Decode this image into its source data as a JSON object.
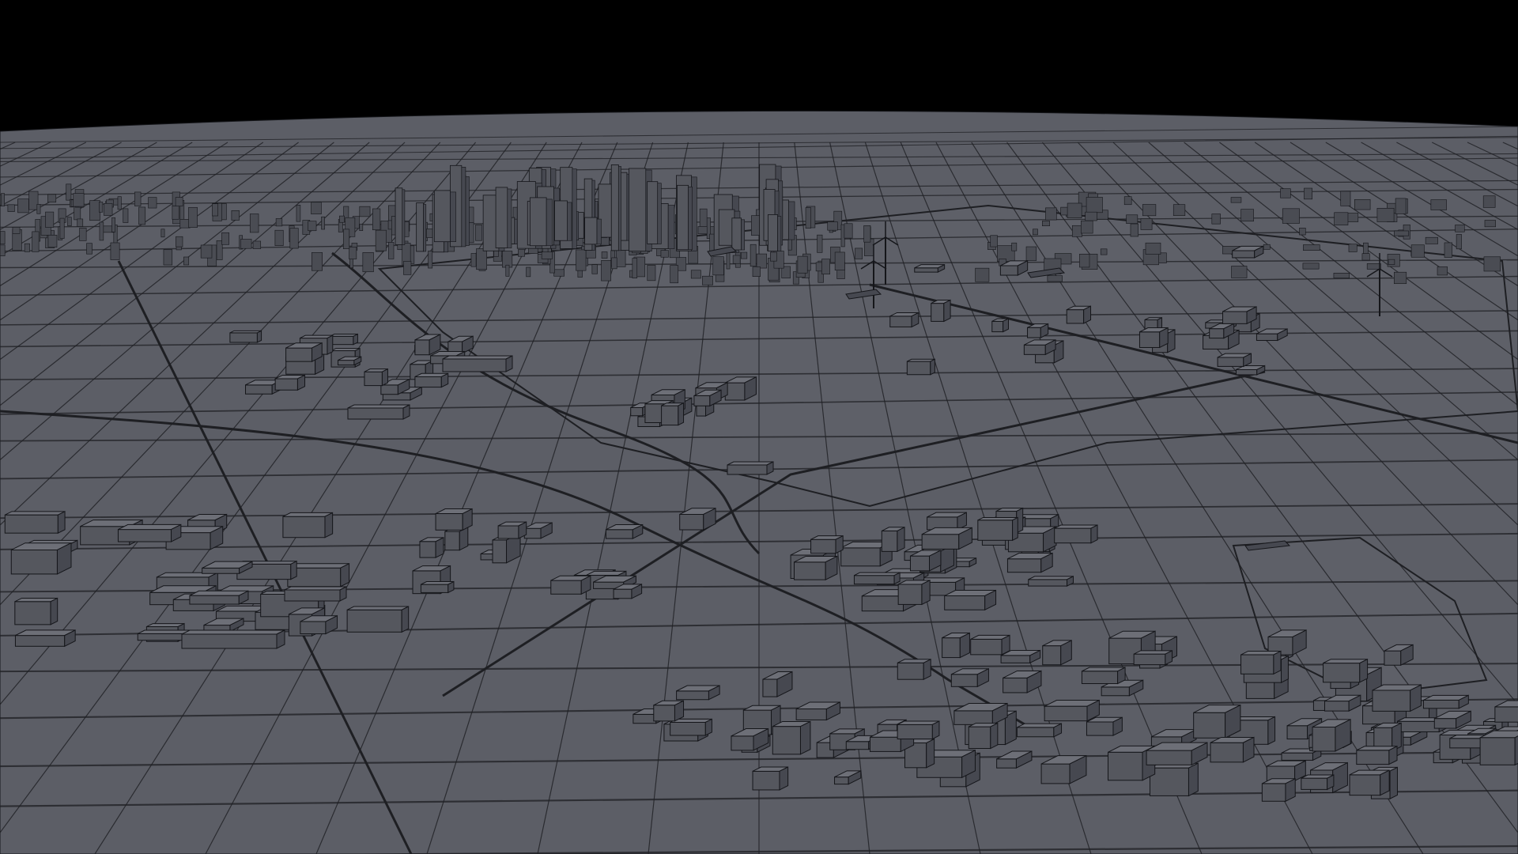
{
  "scene": {
    "kind": "3d-city-model-render",
    "colors": {
      "sky": "#000000",
      "ground": "#5c5e66",
      "ground_far": "#4a4c53",
      "road_line": "#1e1f23",
      "building_top": "#6d6f77",
      "building_side": "#464850",
      "building_front": "#55575e",
      "outline": "#15161a",
      "water": "#5e6068"
    },
    "features": [
      "dense-city-skyline",
      "waterfront",
      "wind-turbines",
      "highway",
      "street-grid",
      "suburban-blocks",
      "ships"
    ]
  }
}
